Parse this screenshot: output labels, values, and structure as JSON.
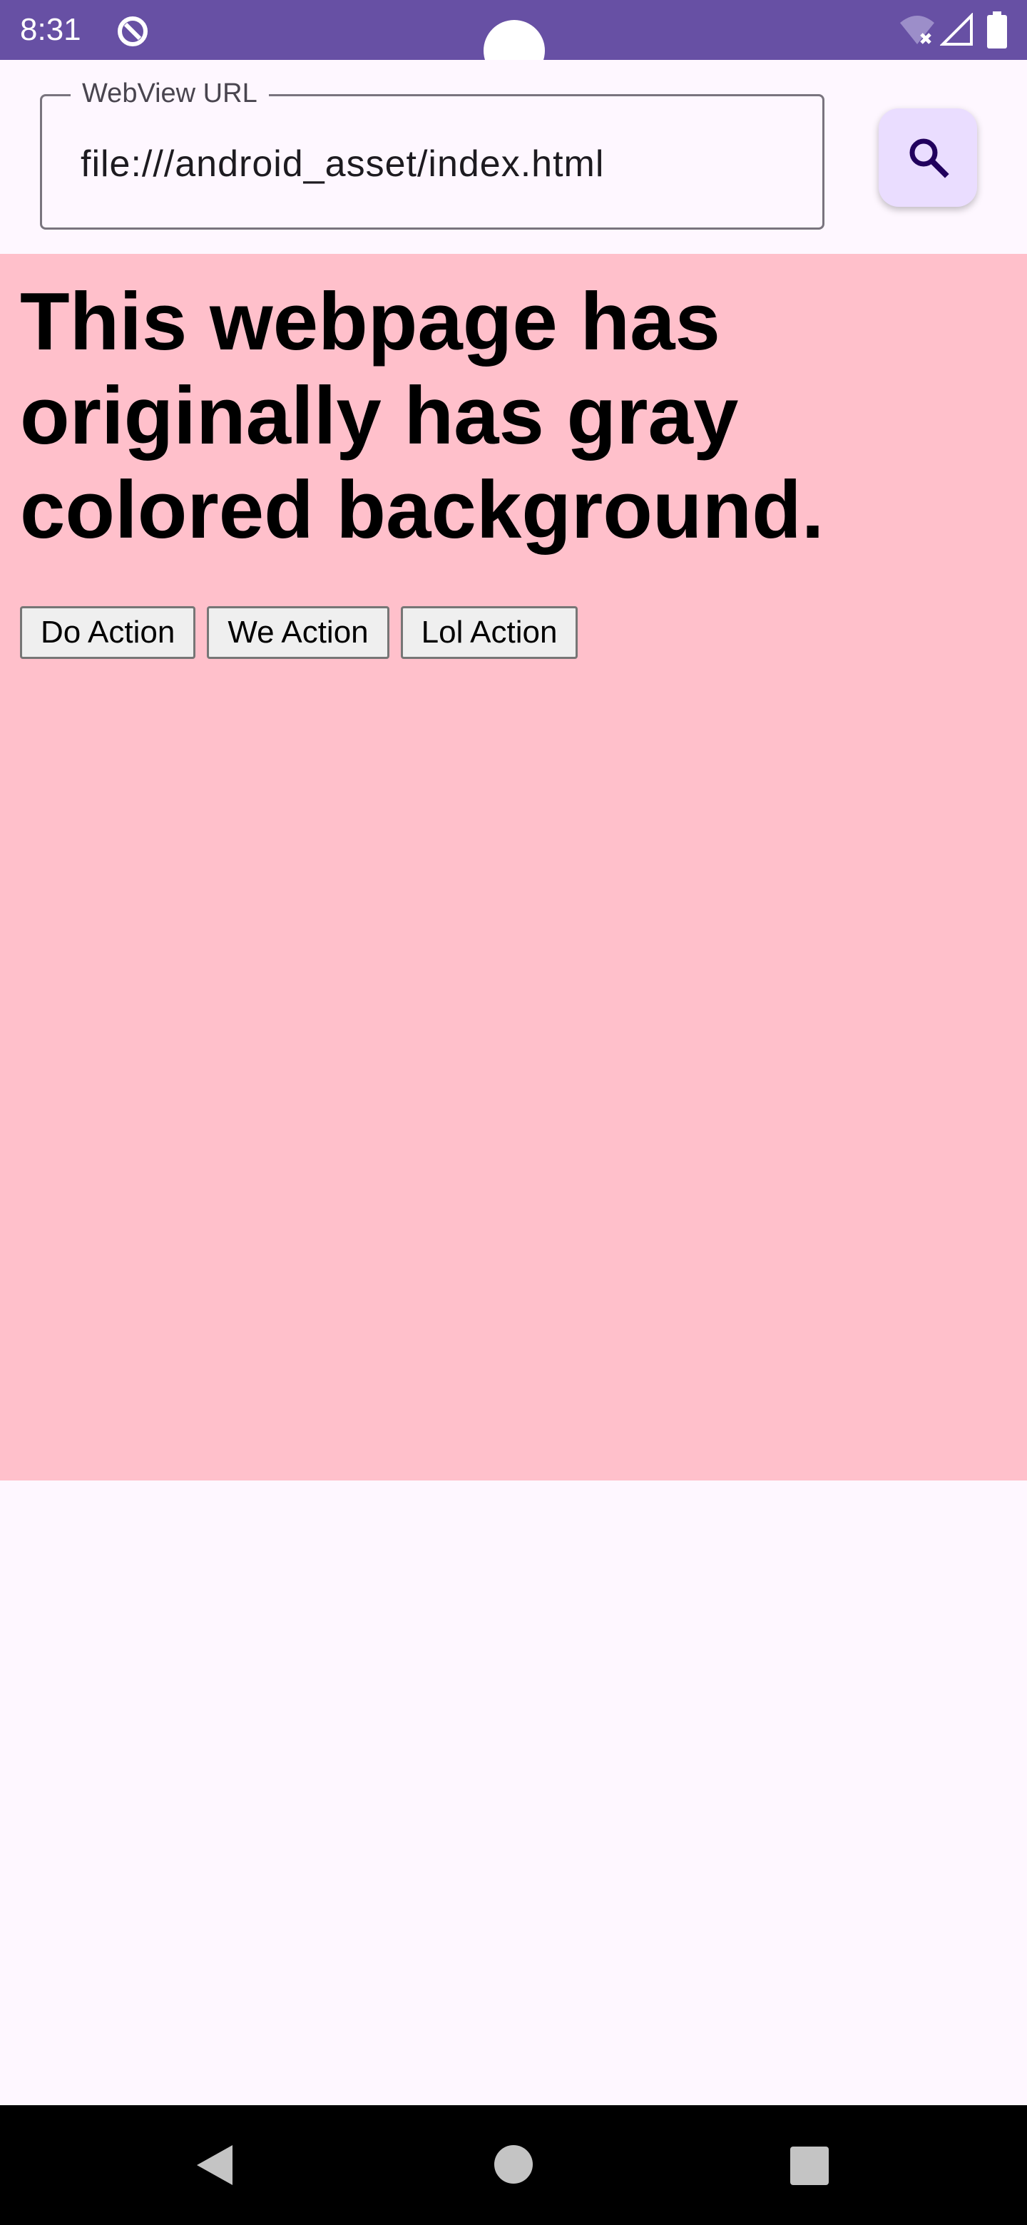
{
  "status_bar": {
    "time": "8:31",
    "color": "#6750a4",
    "icons": [
      "app-notification-icon",
      "wifi-off-icon",
      "cell-signal-icon",
      "battery-icon"
    ]
  },
  "url_bar": {
    "label": "WebView URL",
    "value": "file:///android_asset/index.html",
    "search_icon": "search-icon",
    "button_color": "#eaddff"
  },
  "webview": {
    "background": "#ffc0cb",
    "heading": "This webpage has originally has gray colored background.",
    "buttons": [
      "Do Action",
      "We Action",
      "Lol Action"
    ]
  },
  "nav_bar": {
    "icons": [
      "back-icon",
      "home-icon",
      "recents-icon"
    ]
  }
}
